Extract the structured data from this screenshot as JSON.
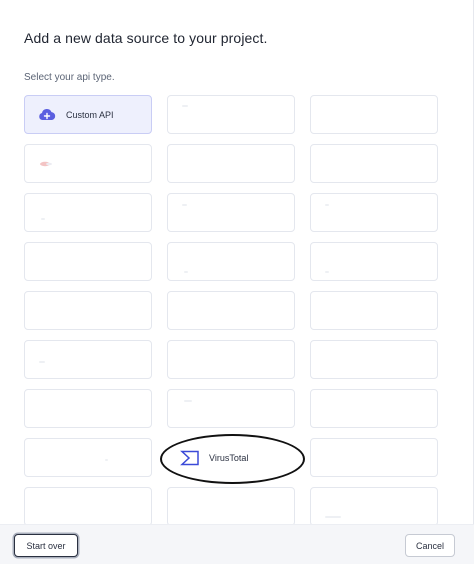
{
  "dialog": {
    "title": "Add a new data source to your project.",
    "subtitle": "Select your api type."
  },
  "cards": [
    {
      "label": "Custom API",
      "icon": "cloud-plus-icon",
      "selected": true
    },
    {
      "label": "",
      "icon": ""
    },
    {
      "label": "",
      "icon": ""
    },
    {
      "label": "",
      "icon": ""
    },
    {
      "label": "",
      "icon": ""
    },
    {
      "label": "",
      "icon": ""
    },
    {
      "label": "",
      "icon": ""
    },
    {
      "label": "",
      "icon": ""
    },
    {
      "label": "",
      "icon": ""
    },
    {
      "label": "",
      "icon": ""
    },
    {
      "label": "",
      "icon": ""
    },
    {
      "label": "",
      "icon": ""
    },
    {
      "label": "",
      "icon": ""
    },
    {
      "label": "",
      "icon": ""
    },
    {
      "label": "",
      "icon": ""
    },
    {
      "label": "",
      "icon": ""
    },
    {
      "label": "",
      "icon": ""
    },
    {
      "label": "",
      "icon": ""
    },
    {
      "label": "",
      "icon": ""
    },
    {
      "label": "",
      "icon": ""
    },
    {
      "label": "",
      "icon": ""
    },
    {
      "label": "",
      "icon": ""
    },
    {
      "label": "VirusTotal",
      "icon": "virustotal-sigma-icon",
      "highlighted": true
    },
    {
      "label": "",
      "icon": ""
    },
    {
      "label": "",
      "icon": ""
    },
    {
      "label": "",
      "icon": ""
    },
    {
      "label": "",
      "icon": ""
    }
  ],
  "footer": {
    "start_over_label": "Start over",
    "cancel_label": "Cancel"
  },
  "colors": {
    "accent": "#5b5fe0",
    "selected_bg": "#eef0fd",
    "highlight_ring": "#111111"
  }
}
